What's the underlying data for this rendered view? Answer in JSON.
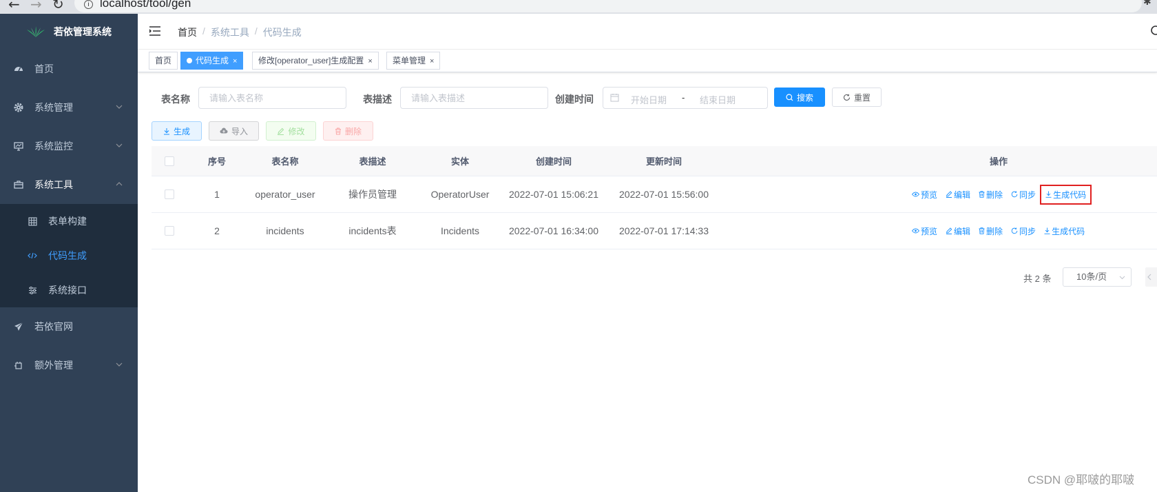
{
  "browser": {
    "url": "localhost/tool/gen"
  },
  "sidebar": {
    "title": "若依管理系统",
    "items": [
      {
        "label": "首页",
        "icon": "dashboard-icon"
      },
      {
        "label": "系统管理",
        "icon": "gear-icon"
      },
      {
        "label": "系统监控",
        "icon": "monitor-icon"
      },
      {
        "label": "系统工具",
        "icon": "toolbox-icon"
      },
      {
        "label": "若依官网",
        "icon": "paper-plane-icon"
      },
      {
        "label": "额外管理",
        "icon": "plugin-icon"
      }
    ],
    "submenu": [
      {
        "label": "表单构建",
        "icon": "table-icon"
      },
      {
        "label": "代码生成",
        "icon": "code-icon"
      },
      {
        "label": "系统接口",
        "icon": "sliders-icon"
      }
    ]
  },
  "breadcrumb": {
    "home": "首页",
    "level1": "系统工具",
    "level2": "代码生成"
  },
  "tags": [
    {
      "label": "首页"
    },
    {
      "label": "代码生成"
    },
    {
      "label": "修改[operator_user]生成配置"
    },
    {
      "label": "菜单管理"
    }
  ],
  "search": {
    "table_name_label": "表名称",
    "table_name_placeholder": "请输入表名称",
    "table_desc_label": "表描述",
    "table_desc_placeholder": "请输入表描述",
    "create_time_label": "创建时间",
    "start_placeholder": "开始日期",
    "range_separator": "-",
    "end_placeholder": "结束日期",
    "search_button": "搜索",
    "reset_button": "重置"
  },
  "toolbar": {
    "generate": "生成",
    "import": "导入",
    "edit": "修改",
    "delete": "删除"
  },
  "table": {
    "headers": {
      "index": "序号",
      "table_name": "表名称",
      "table_desc": "表描述",
      "entity": "实体",
      "create_time": "创建时间",
      "update_time": "更新时间",
      "actions": "操作"
    },
    "rows": [
      {
        "index": "1",
        "table_name": "operator_user",
        "table_desc": "操作员管理",
        "entity": "OperatorUser",
        "create_time": "2022-07-01 15:06:21",
        "update_time": "2022-07-01 15:56:00"
      },
      {
        "index": "2",
        "table_name": "incidents",
        "table_desc": "incidents表",
        "entity": "Incidents",
        "create_time": "2022-07-01 16:34:00",
        "update_time": "2022-07-01 17:14:33"
      }
    ],
    "actions": {
      "preview": "预览",
      "edit": "编辑",
      "delete": "删除",
      "sync": "同步",
      "generate_code": "生成代码"
    }
  },
  "pagination": {
    "total": "共 2 条",
    "page_size": "10条/页"
  },
  "watermark": "CSDN @耶啵的耶啵",
  "colors": {
    "sidebar_bg": "#304156",
    "submenu_bg": "#1f2d3d",
    "primary": "#1890ff",
    "highlight_box": "#e02020"
  }
}
